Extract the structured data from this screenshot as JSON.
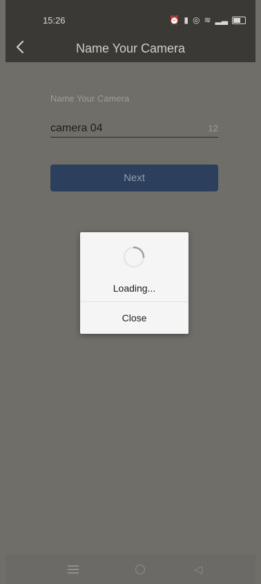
{
  "status_bar": {
    "time": "15:26",
    "icons": [
      "alarm-icon",
      "vibrate-icon",
      "location-icon",
      "wifi-icon",
      "signal-icon",
      "battery-icon"
    ]
  },
  "header": {
    "title": "Name Your Camera"
  },
  "form": {
    "label": "Name Your Camera",
    "value": "camera 04",
    "count": "12",
    "next_label": "Next"
  },
  "dialog": {
    "loading_text": "Loading...",
    "close_label": "Close"
  },
  "colors": {
    "header_bg": "#3a3935",
    "button_bg": "#2c3f5c",
    "overlay_bg": "#6f6e69"
  }
}
